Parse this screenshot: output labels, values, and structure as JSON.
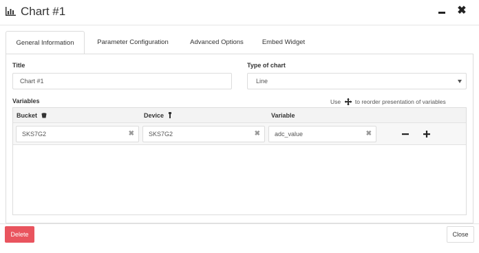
{
  "header": {
    "title": "Chart #1",
    "icon": "bar-chart-icon",
    "minimize_icon": "minimize-icon",
    "close_icon": "close-icon",
    "close_glyph": "✖"
  },
  "tabs": [
    {
      "label": "General Information",
      "active": true
    },
    {
      "label": "Parameter Configuration",
      "active": false
    },
    {
      "label": "Advanced Options",
      "active": false
    },
    {
      "label": "Embed Widget",
      "active": false
    }
  ],
  "form": {
    "title_label": "Title",
    "title_value": "Chart #1",
    "type_label": "Type of chart",
    "type_value": "Line"
  },
  "variables": {
    "label": "Variables",
    "hint_prefix": "Use",
    "hint_icon": "move-icon",
    "hint_suffix": "to reorder presentation of variables",
    "columns": [
      {
        "label": "Bucket",
        "icon": "bucket-icon"
      },
      {
        "label": "Device",
        "icon": "device-icon"
      },
      {
        "label": "Variable",
        "icon": ""
      }
    ],
    "rows": [
      {
        "bucket": "SKS7G2",
        "device": "SKS7G2",
        "variable": "adc_value"
      }
    ],
    "clear_glyph": "✖",
    "remove_icon": "minus-icon",
    "add_icon": "plus-icon"
  },
  "footer": {
    "delete_label": "Delete",
    "close_label": "Close"
  },
  "colors": {
    "delete_button": "#e9545e",
    "header_row": "#f3f3f3",
    "border": "#dcdcdc"
  }
}
